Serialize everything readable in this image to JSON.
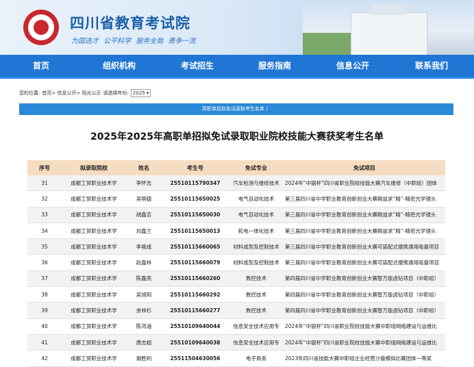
{
  "header": {
    "title": "四川省教育考试院",
    "slogan": "为国选才  公平科学  服务全局  勇争一流"
  },
  "nav": {
    "items": [
      "首页",
      "组织机构",
      "考试招生",
      "服务指南",
      "信息公开",
      "联系我们"
    ]
  },
  "breadcrumb": {
    "label": "您的位置:",
    "path": "首页> 信息公开> 阳光公示",
    "year_label": "请选择年份:",
    "year_value": "2025"
  },
  "banner": {
    "text": "高职单招拟免试录取考生名单"
  },
  "page_title": "2025年2025年高职单招拟免试录取职业院校技能大赛获奖考生名单",
  "table": {
    "headers": [
      "序号",
      "拟录取院校",
      "姓名",
      "考生号",
      "免试专业",
      "免试项目"
    ],
    "rows": [
      [
        "31",
        "成都工贸职业技术学",
        "李怀志",
        "25510115790347",
        "汽车检测与维修技术",
        "2024年“中银杯”四川省职业院校技能大赛汽车维修（中职组）团体"
      ],
      [
        "32",
        "成都工贸职业技术学",
        "吴明德",
        "25510115650025",
        "电气自动化技术",
        "第三届四川省中学职业教育创新创业大赛精益求“精”-精密光学镜头"
      ],
      [
        "33",
        "成都工贸职业技术学",
        "胡鑫吉",
        "25510115650030",
        "电气自动化技术",
        "第三届四川省中学职业教育创新创业大赛精益求“精”-精密光学镜头"
      ],
      [
        "34",
        "成都工贸职业技术学",
        "刘鑫兰",
        "25510115650013",
        "机电一体化技术",
        "第三届四川省中学职业教育创新创业大赛精益求“精”-精密光学镜头"
      ],
      [
        "35",
        "成都工贸职业技术学",
        "李艳成",
        "25510115660065",
        "材料成型及控制技术",
        "第三届四川省中学职业教育创新创业大赛可装配式便携通用吸盘项目"
      ],
      [
        "36",
        "成都工贸职业技术学",
        "赵鑫林",
        "25510115660079",
        "材料成型及控制技术",
        "第三届四川省中学职业教育创新创业大赛可装配式便携通用吸盘项目"
      ],
      [
        "37",
        "成都工贸职业技术学",
        "陈鑫亮",
        "25510115660260",
        "数控技术",
        "第四届四川省中学职业教育创新创业大赛智万能卤钻项目（中职组）"
      ],
      [
        "38",
        "成都工贸职业技术学",
        "吴旭阳",
        "25510115660292",
        "数控技术",
        "第四届四川省中学职业教育创新创业大赛智万能卤钻项目（中职组）"
      ],
      [
        "39",
        "成都工贸职业技术学",
        "余林杉",
        "25510115660277",
        "数控技术",
        "第四届四川省中学职业教育创新创业大赛智万能卤钻项目（中职组）"
      ],
      [
        "40",
        "成都工贸职业技术学",
        "陈鸿涵",
        "25510109640044",
        "信息安全技术应用专",
        "2024年“中银杯”四川省职业院校技能大赛中职组网络建设与运维比"
      ],
      [
        "41",
        "成都工贸职业技术学",
        "唐志超",
        "25510109640038",
        "信息安全技术应用专",
        "2024年“中银杯”四川省职业院校技能大赛中职组网络建设与运维比"
      ],
      [
        "42",
        "成都工贸职业技术学",
        "谢胜利",
        "25511504630056",
        "电子商务",
        "2023年四川省技能大赛中职组企业经营沙盘模拟比赛团体一等奖"
      ]
    ]
  }
}
